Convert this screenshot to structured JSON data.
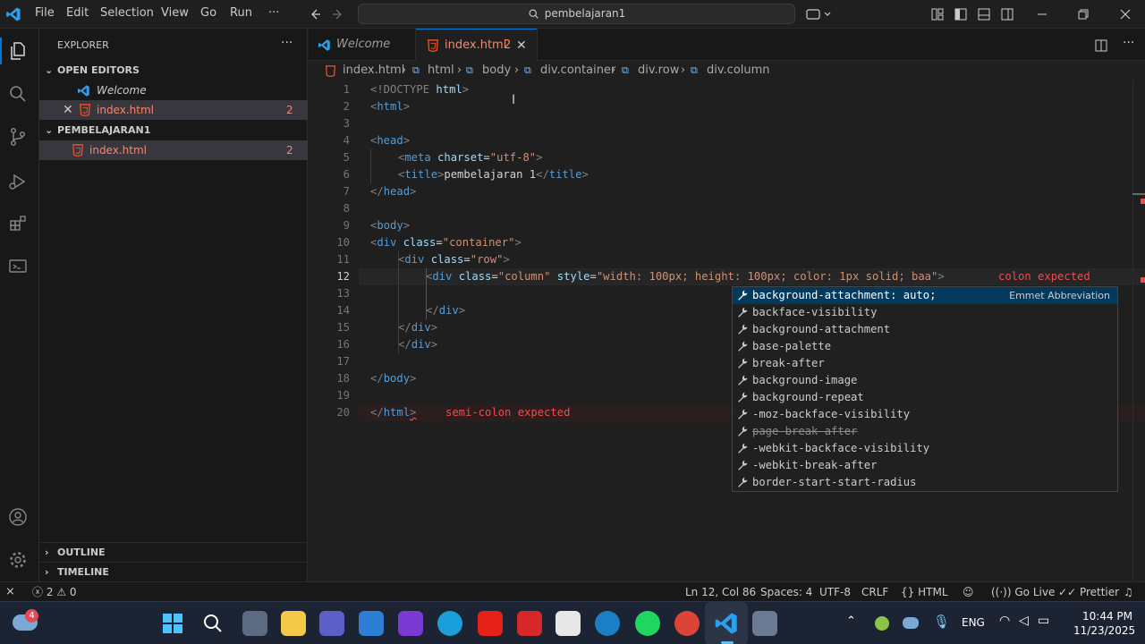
{
  "titlebar": {
    "menu": [
      "File",
      "Edit",
      "Selection",
      "View",
      "Go",
      "Run",
      "···"
    ],
    "search": "pembelajaran1"
  },
  "sidebar": {
    "title": "EXPLORER",
    "more": "···",
    "open_editors_label": "OPEN EDITORS",
    "open_editors": [
      {
        "name": "Welcome",
        "badge": ""
      },
      {
        "name": "index.html",
        "badge": "2"
      }
    ],
    "folder_label": "PEMBELAJARAN1",
    "files": [
      {
        "name": "index.html",
        "badge": "2"
      }
    ],
    "outline_label": "OUTLINE",
    "timeline_label": "TIMELINE"
  },
  "tabs": [
    {
      "label": "Welcome",
      "active": false
    },
    {
      "label": "index.html",
      "badge": "2",
      "active": true
    }
  ],
  "breadcrumb": [
    "index.html",
    "html",
    "body",
    "div.container",
    "div.row",
    "div.column"
  ],
  "editor": {
    "lines": [
      {
        "n": "1"
      },
      {
        "n": "2"
      },
      {
        "n": "3"
      },
      {
        "n": "4"
      },
      {
        "n": "5"
      },
      {
        "n": "6"
      },
      {
        "n": "7"
      },
      {
        "n": "8"
      },
      {
        "n": "9"
      },
      {
        "n": "10"
      },
      {
        "n": "11"
      },
      {
        "n": "12"
      },
      {
        "n": "13"
      },
      {
        "n": "14"
      },
      {
        "n": "15"
      },
      {
        "n": "16"
      },
      {
        "n": "17"
      },
      {
        "n": "18"
      },
      {
        "n": "19"
      },
      {
        "n": "20"
      }
    ],
    "code": {
      "l1_doctype": "<!DOCTYPE",
      "l1_html": "html",
      "l1_close": ">",
      "l5_meta": "meta",
      "l5_attr": "charset",
      "l5_val": "\"utf-8\"",
      "l6_title_text": "pembelajaran 1",
      "l10_val": "\"container\"",
      "l11_val": "\"row\"",
      "l12_col": "\"column\"",
      "l12_style": "\"width: 100px; height: 100px; color: 1px solid; baa\"",
      "l12_error": "colon expected",
      "l20_error": "semi-colon expected",
      "tag_html": "html",
      "tag_head": "head",
      "tag_title": "title",
      "tag_body": "body",
      "tag_div": "div",
      "attr_class": "class",
      "attr_style": "style"
    }
  },
  "suggest": {
    "detail": "Emmet Abbreviation",
    "items": [
      {
        "label": "background-attachment: auto;",
        "selected": true,
        "strike": false
      },
      {
        "label": "backface-visibility",
        "selected": false,
        "strike": false
      },
      {
        "label": "background-attachment",
        "selected": false,
        "strike": false
      },
      {
        "label": "base-palette",
        "selected": false,
        "strike": false
      },
      {
        "label": "break-after",
        "selected": false,
        "strike": false
      },
      {
        "label": "background-image",
        "selected": false,
        "strike": false
      },
      {
        "label": "background-repeat",
        "selected": false,
        "strike": false
      },
      {
        "label": "-moz-backface-visibility",
        "selected": false,
        "strike": false
      },
      {
        "label": "page-break-after",
        "selected": false,
        "strike": true
      },
      {
        "label": "-webkit-backface-visibility",
        "selected": false,
        "strike": false
      },
      {
        "label": "-webkit-break-after",
        "selected": false,
        "strike": false
      },
      {
        "label": "border-start-start-radius",
        "selected": false,
        "strike": false
      }
    ]
  },
  "statusbar": {
    "errors": "2",
    "warnings": "0",
    "position": "Ln 12, Col 86",
    "spaces": "Spaces: 4",
    "encoding": "UTF-8",
    "eol": "CRLF",
    "language": "HTML",
    "golive": "Go Live",
    "prettier": "Prettier"
  },
  "taskbar": {
    "weather_badge": "4",
    "lang": "ENG",
    "time": "10:44 PM",
    "date": "11/23/2025"
  },
  "colors": {
    "accent": "#0078d4",
    "error": "#f14c4c",
    "modified": "#e2c08d"
  }
}
